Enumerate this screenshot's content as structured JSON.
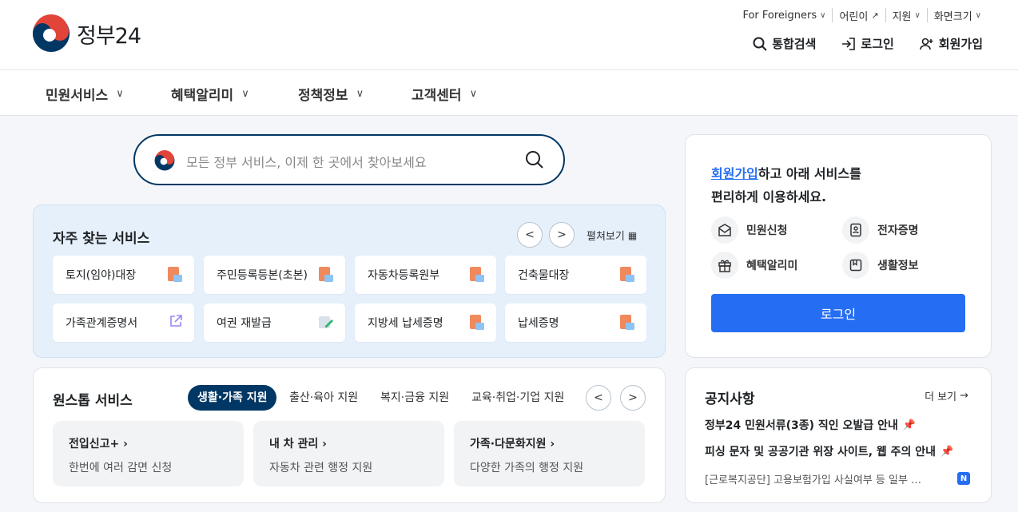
{
  "header": {
    "logo_text": "정부24",
    "utility": [
      "For Foreigners",
      "어린이",
      "지원",
      "화면크기"
    ],
    "search_btn": "통합검색",
    "login_btn": "로그인",
    "signup_btn": "회원가입"
  },
  "nav": [
    "민원서비스",
    "혜택알리미",
    "정책정보",
    "고객센터"
  ],
  "search": {
    "placeholder": "모든 정부 서비스, 이제 한 곳에서 찾아보세요"
  },
  "frequent": {
    "title": "자주 찾는 서비스",
    "more": "펼쳐보기",
    "items": [
      "토지(임야)대장",
      "주민등록등본(초본)",
      "자동차등록원부",
      "건축물대장",
      "가족관계증명서",
      "여권 재발급",
      "지방세 납세증명",
      "납세증명"
    ]
  },
  "onestop": {
    "title": "원스톱 서비스",
    "tabs": [
      "생활·가족 지원",
      "출산·육아 지원",
      "복지·금융 지원",
      "교육·취업·기업 지원"
    ],
    "cards": [
      {
        "title": "전입신고+",
        "desc": "한번에 여러 감면 신청"
      },
      {
        "title": "내 차 관리",
        "desc": "자동차 관련 행정 지원"
      },
      {
        "title": "가족·다문화지원",
        "desc": "다양한 가족의 행정 지원"
      }
    ]
  },
  "login_box": {
    "link": "회원가입",
    "msg1": "하고 아래 서비스를",
    "msg2": "편리하게 이용하세요.",
    "services": [
      "민원신청",
      "전자증명",
      "혜택알리미",
      "생활정보"
    ],
    "button": "로그인"
  },
  "notice": {
    "title": "공지사항",
    "more": "더 보기",
    "items": [
      "정부24 민원서류(3종) 직인 오발급 안내",
      "피싱 문자 및 공공기관 위장 사이트, 웹 주의 안내",
      "[근로복지공단] 고용보험가입 사실여부 등 일부 …"
    ],
    "badge": "N"
  },
  "colors": {
    "navy": "#003764",
    "blue": "#256ef4",
    "red": "#e2443a"
  }
}
